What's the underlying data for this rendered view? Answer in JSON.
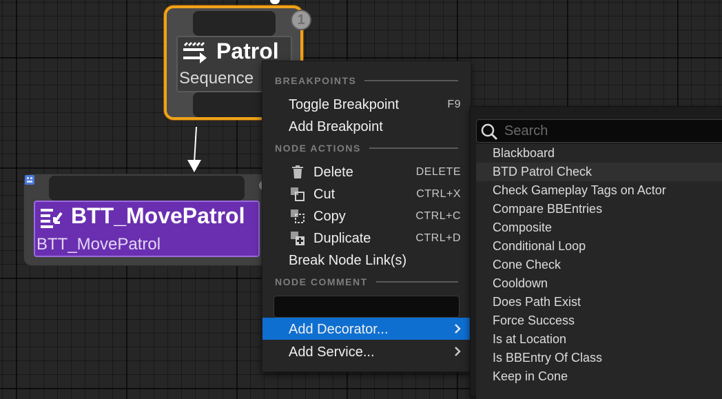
{
  "graph": {
    "patrol_node": {
      "title": "Patrol",
      "subtitle": "Sequence",
      "badge": "1"
    },
    "move_node": {
      "title": "BTT_MovePatrol",
      "subtitle": "BTT_MovePatrol"
    }
  },
  "colors": {
    "selection_outline": "#f0a21a",
    "task_node": "#6a2fb0",
    "menu_highlight": "#0f6fd1",
    "menu_bg": "#262626"
  },
  "context_menu": {
    "sections": {
      "breakpoints": "BREAKPOINTS",
      "node_actions": "NODE ACTIONS",
      "node_comment": "NODE COMMENT"
    },
    "items": {
      "toggle_breakpoint": {
        "label": "Toggle Breakpoint",
        "shortcut": "F9"
      },
      "add_breakpoint": {
        "label": "Add Breakpoint"
      },
      "delete": {
        "label": "Delete",
        "shortcut": "DELETE",
        "icon": "trash-icon"
      },
      "cut": {
        "label": "Cut",
        "shortcut": "CTRL+X",
        "icon": "cut-icon"
      },
      "copy": {
        "label": "Copy",
        "shortcut": "CTRL+C",
        "icon": "copy-icon"
      },
      "duplicate": {
        "label": "Duplicate",
        "shortcut": "CTRL+D",
        "icon": "duplicate-icon"
      },
      "break_links": {
        "label": "Break Node Link(s)"
      },
      "add_decorator": {
        "label": "Add Decorator..."
      },
      "add_service": {
        "label": "Add Service..."
      }
    },
    "comment_value": ""
  },
  "submenu": {
    "search_placeholder": "Search",
    "items": [
      "Blackboard",
      "BTD Patrol Check",
      "Check Gameplay Tags on Actor",
      "Compare BBEntries",
      "Composite",
      "Conditional Loop",
      "Cone Check",
      "Cooldown",
      "Does Path Exist",
      "Force Success",
      "Is at Location",
      "Is BBEntry Of Class",
      "Keep in Cone"
    ],
    "hovered_item": "BTD Patrol Check"
  }
}
